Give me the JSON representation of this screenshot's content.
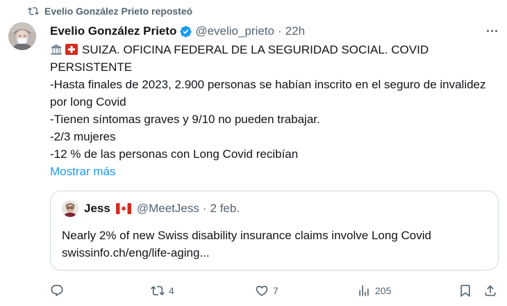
{
  "repost": {
    "text": "Evelio González Prieto reposteó",
    "icon": "repost-icon"
  },
  "tweet": {
    "author_name": "Evelio González Prieto",
    "handle": "@evelio_prieto",
    "separator": "·",
    "time": "22h",
    "lines": [
      "SUIZA. OFICINA FEDERAL DE LA SEGURIDAD SOCIAL. COVID PERSISTENTE",
      "-Hasta finales de 2023, 2.900 personas se habían inscrito en el seguro de invalidez por long Covid",
      "-Tienen síntomas graves y 9/10 no pueden trabajar.",
      "-2/3 mujeres",
      "-12 % de las personas con Long Covid recibían"
    ],
    "show_more": "Mostrar más"
  },
  "quote": {
    "author_name": "Jess",
    "handle": "@MeetJess",
    "separator": "·",
    "date": "2 feb.",
    "lines": [
      "Nearly 2% of new Swiss disability insurance claims involve Long Covid",
      "swissinfo.ch/eng/life-aging..."
    ]
  },
  "actions": {
    "reply_count": "",
    "repost_count": "4",
    "like_count": "7",
    "views_count": "205"
  },
  "colors": {
    "text": "#0f1419",
    "muted": "#536471",
    "link": "#1d9bf0",
    "verified": "#1d9bf0",
    "border": "#cfd9de"
  }
}
